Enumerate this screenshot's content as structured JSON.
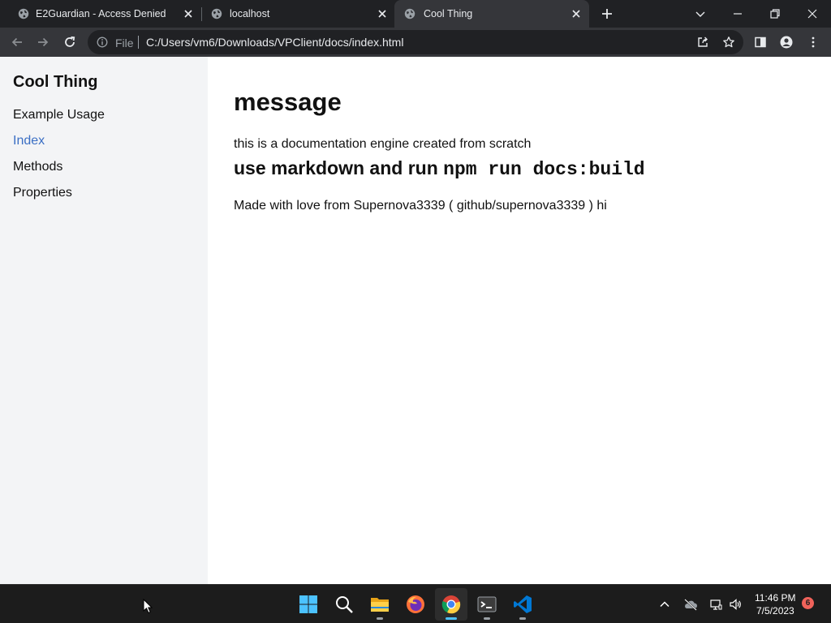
{
  "browser": {
    "tabs": [
      {
        "title": "E2Guardian - Access Denied",
        "icon": "globe-icon",
        "active": false
      },
      {
        "title": "localhost",
        "icon": "globe-icon",
        "active": false
      },
      {
        "title": "Cool Thing",
        "icon": "globe-icon",
        "active": true
      }
    ],
    "address_bar": {
      "scheme_label": "File",
      "url": "C:/Users/vm6/Downloads/VPClient/docs/index.html"
    },
    "colors": {
      "tabstrip": "#202124",
      "toolbar": "#35363a",
      "omnibox": "#202124"
    }
  },
  "page": {
    "sidebar": {
      "title": "Cool Thing",
      "links": [
        {
          "label": "Example Usage",
          "active": false
        },
        {
          "label": "Index",
          "active": true
        },
        {
          "label": "Methods",
          "active": false
        },
        {
          "label": "Properties",
          "active": false
        }
      ],
      "colors": {
        "background": "#f3f4f6",
        "active_link": "#3b6fc4"
      }
    },
    "content": {
      "heading": "message",
      "paragraph": "this is a documentation engine created from scratch",
      "subheading_prefix": "use markdown and run ",
      "subheading_code": "npm run docs:build",
      "footer_text": "Made with love from Supernova3339 ( github/supernova3339 ) hi"
    }
  },
  "taskbar": {
    "apps": [
      "windows-start-icon",
      "search-icon",
      "file-explorer-icon",
      "firefox-icon",
      "chrome-icon",
      "terminal-icon",
      "vscode-icon"
    ],
    "active_app": "chrome-icon",
    "tray_icons": [
      "chevron-up-icon",
      "onedrive-offline-icon",
      "network-icon",
      "volume-icon"
    ],
    "clock": {
      "time": "11:46 PM",
      "date": "7/5/2023"
    },
    "notification_count": "6"
  }
}
